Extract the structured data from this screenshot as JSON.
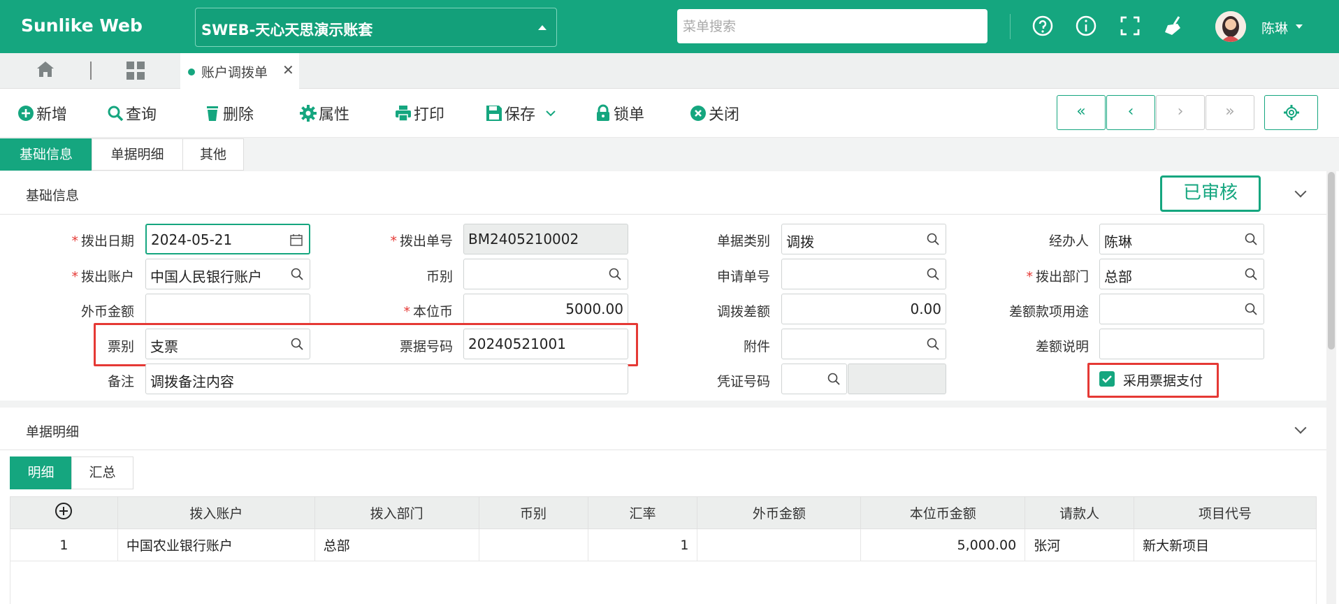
{
  "header": {
    "brand": "Sunlike Web",
    "account": "SWEB-天心天思演示账套",
    "search_placeholder": "菜单搜索",
    "user_name": "陈琳"
  },
  "tabs": {
    "open_tab": "账户调拨单"
  },
  "toolbar": {
    "add": "新增",
    "query": "查询",
    "delete": "删除",
    "properties": "属性",
    "print": "打印",
    "save": "保存",
    "lock": "锁单",
    "close": "关闭",
    "first": "«",
    "prev": "‹",
    "next": "›",
    "last": "»"
  },
  "section_tabs": [
    "基础信息",
    "单据明细",
    "其他"
  ],
  "basic": {
    "title": "基础信息",
    "status_stamp": "已审核",
    "fields": {
      "out_date_label": "拨出日期",
      "out_date": "2024-05-21",
      "out_no_label": "拨出单号",
      "out_no": "BM2405210002",
      "doc_type_label": "单据类别",
      "doc_type": "调拨",
      "handler_label": "经办人",
      "handler": "陈琳",
      "out_account_label": "拨出账户",
      "out_account": "中国人民银行账户",
      "currency_label": "币别",
      "currency": "",
      "apply_no_label": "申请单号",
      "apply_no": "",
      "out_dept_label": "拨出部门",
      "out_dept": "总部",
      "foreign_amt_label": "外币金额",
      "foreign_amt": "",
      "local_cur_label": "本位币",
      "local_cur": "5000.00",
      "diff_label": "调拨差额",
      "diff": "0.00",
      "diff_use_label": "差额款项用途",
      "diff_use": "",
      "bill_type_label": "票别",
      "bill_type": "支票",
      "bill_no_label": "票据号码",
      "bill_no": "20240521001",
      "attach_label": "附件",
      "attach": "",
      "diff_note_label": "差额说明",
      "diff_note": "",
      "remark_label": "备注",
      "remark": "调拨备注内容",
      "voucher_label": "凭证号码",
      "voucher": "",
      "use_bill_label": "采用票据支付"
    }
  },
  "detail": {
    "title": "单据明细",
    "sub_tabs": [
      "明细",
      "汇总"
    ],
    "columns": [
      "拨入账户",
      "拨入部门",
      "币别",
      "汇率",
      "外币金额",
      "本位币金额",
      "请款人",
      "项目代号"
    ],
    "rows": [
      [
        "1",
        "中国农业银行账户",
        "总部",
        "",
        "1",
        "",
        "5,000.00",
        "张河",
        "新大新项目"
      ]
    ]
  },
  "colors": {
    "accent": "#15a67f",
    "highlight": "#e53935"
  }
}
